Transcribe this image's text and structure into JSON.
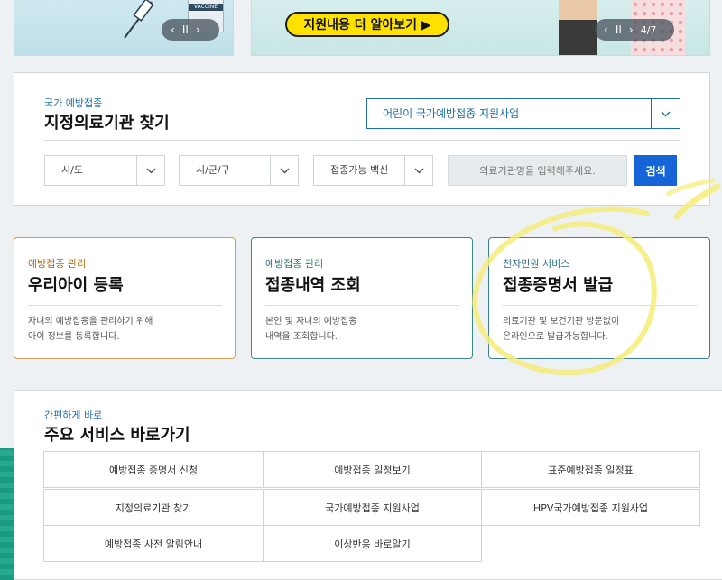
{
  "banners": {
    "left": {
      "vaccine_label": "VACCINE",
      "pager_pause": "II"
    },
    "right": {
      "more_button": "지원내용 더 알아보기 ▶",
      "pager_pause": "II",
      "page_indicator": "4/7"
    }
  },
  "finder": {
    "eyebrow": "국가 예방접종",
    "title": "지정의료기관 찾기",
    "program_select": "어린이 국가예방접종 지원사업",
    "sido_select": "시/도",
    "sigungu_select": "시/군/구",
    "vaccine_select": "접종가능 백신",
    "name_placeholder": "의료기관명을 입력해주세요.",
    "search_button": "검색"
  },
  "services": [
    {
      "eyebrow": "예방접종 관리",
      "title": "우리아이 등록",
      "desc_1": "자녀의 예방접종을 관리하기 위해",
      "desc_2": "아이 정보를 등록합니다."
    },
    {
      "eyebrow": "예방접종 관리",
      "title": "접종내역 조회",
      "desc_1": "본인 및 자녀의 예방접종",
      "desc_2": "내역을 조회합니다."
    },
    {
      "eyebrow": "전자민원 서비스",
      "title": "접종증명서 발급",
      "desc_1": "의료기관 및 보건기관 방문없이",
      "desc_2": "온라인으로 발급가능합니다."
    }
  ],
  "quick": {
    "eyebrow": "간편하게 바로",
    "title": "주요 서비스 바로가기",
    "links": [
      "예방접종 증명서 신청",
      "예방접종 일정보기",
      "표준예방접종 일정표",
      "지정의료기관 찾기",
      "국가예방접종 지원사업",
      "HPV국가예방접종 지원사업",
      "예방접종 사전 알림안내",
      "이상반응 바로알기"
    ]
  },
  "colors": {
    "accent_blue": "#1565d8",
    "link_blue": "#1d6fa5",
    "highlight_yellow": "#ffe100"
  }
}
